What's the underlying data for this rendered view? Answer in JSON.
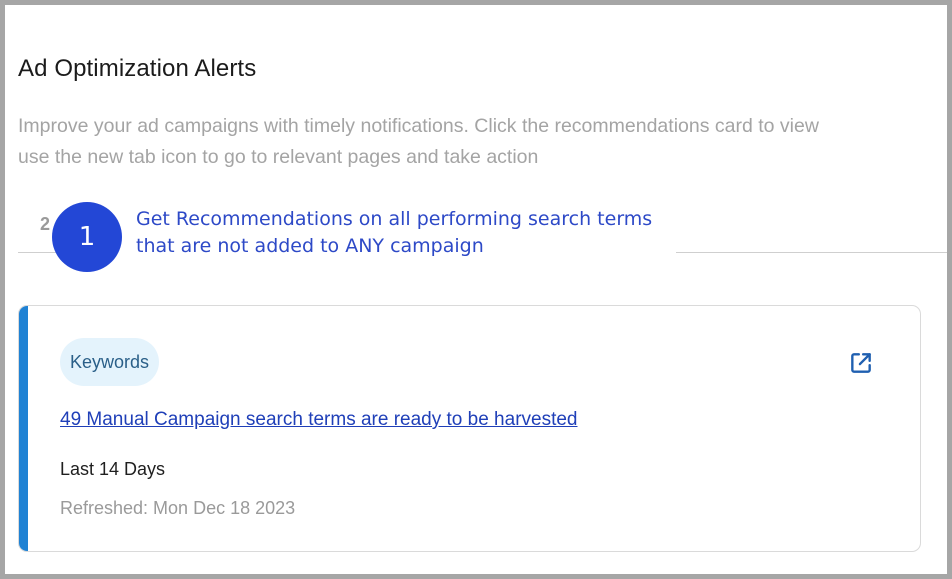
{
  "page": {
    "title": "Ad Optimization Alerts",
    "description_line1": "Improve your ad campaigns with timely notifications. Click the recommendations card to view",
    "description_line2": "use the new tab icon to go to relevant pages and take action"
  },
  "tabs": {
    "visible_fragment": "2"
  },
  "callout": {
    "number": "1",
    "line1": "Get Recommendations on all performing search terms",
    "line2": "that are not added to ANY campaign"
  },
  "alert_card": {
    "chip_label": "Keywords",
    "link_text": "49 Manual Campaign search terms are ready to be harvested",
    "period": "Last 14 Days",
    "refreshed": "Refreshed: Mon Dec 18 2023",
    "icon": "open-in-new-tab-icon",
    "accent_color": "#1f82d4"
  },
  "colors": {
    "callout_circle": "#2347d6",
    "callout_text": "#2d49c7",
    "link": "#1f3fb8",
    "chip_background": "#e4f3fc"
  }
}
